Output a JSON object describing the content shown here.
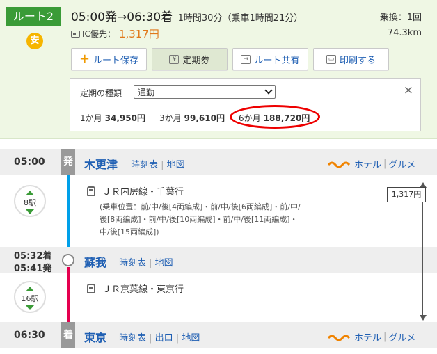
{
  "route": {
    "label": "ルート2",
    "badge": "安",
    "time_range": "05:00発→06:30着",
    "duration": "1時間30分（乗車1時間21分）",
    "transfers": "乗換：1回",
    "ic_label": "IC優先：",
    "ic_fare": "1,317円",
    "distance": "74.3km"
  },
  "toolbar": {
    "save_label": "ルート保存",
    "pass_label": "定期券",
    "share_label": "ルート共有",
    "print_label": "印刷する"
  },
  "pass_panel": {
    "type_label": "定期の種類",
    "type_value": "通勤",
    "close_glyph": "×",
    "fares": [
      {
        "period": "1か月",
        "price": "34,950円"
      },
      {
        "period": "3か月",
        "price": "99,610円"
      },
      {
        "period": "6か月",
        "price": "188,720円"
      }
    ]
  },
  "stations": [
    {
      "time": "05:00",
      "badge": "発",
      "name": "木更津",
      "links": [
        "時刻表",
        "地図"
      ]
    },
    {
      "time_arr": "05:32着",
      "time_dep": "05:41発",
      "name": "蘇我",
      "links": [
        "時刻表",
        "地図"
      ]
    },
    {
      "time": "06:30",
      "badge": "着",
      "name": "東京",
      "links": [
        "時刻表",
        "出口",
        "地図"
      ]
    }
  ],
  "segments": [
    {
      "stops": "8駅",
      "train": "ＪＲ内房線・千葉行",
      "car_position": [
        "(乗車位置：前/中/後[4両編成]・前/中/後[6両編成]・前/中/",
        "後[8両編成]・前/中/後[10両編成]・前/中/後[11両編成]・",
        "中/後[15両編成])"
      ]
    },
    {
      "stops": "16駅",
      "train": "ＪＲ京葉線・東京行"
    }
  ],
  "extras": {
    "hotel": "ホテル",
    "gourmet": "グルメ"
  },
  "segment_fare": "1,317円",
  "colors": {
    "green": "#3a9b37",
    "blue_line": "#00a0e9",
    "pink_line": "#e5004f",
    "link": "#1f5fb3",
    "highlight": "#ee0000"
  }
}
